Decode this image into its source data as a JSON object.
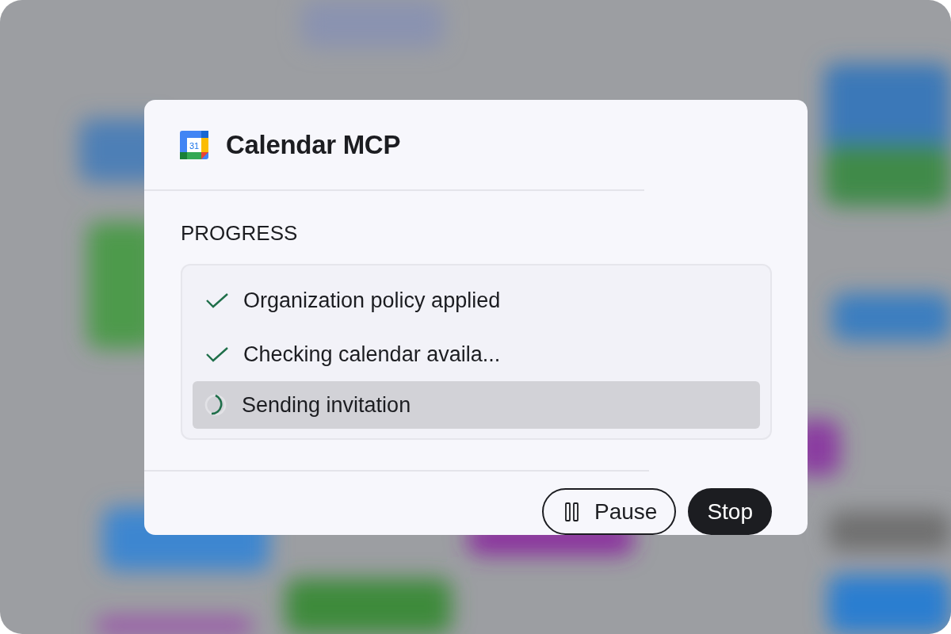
{
  "dialog": {
    "title": "Calendar MCP",
    "app_icon_label": "31",
    "section_label": "PROGRESS",
    "steps": [
      {
        "label": "Organization policy applied",
        "kind": "done"
      },
      {
        "label": "Checking calendar availa...",
        "kind": "done"
      },
      {
        "label": "Sending invitation",
        "kind": "running"
      }
    ],
    "buttons": [
      {
        "label": "Pause",
        "kind": "secondary"
      },
      {
        "label": "Stop",
        "kind": "primary"
      }
    ]
  }
}
